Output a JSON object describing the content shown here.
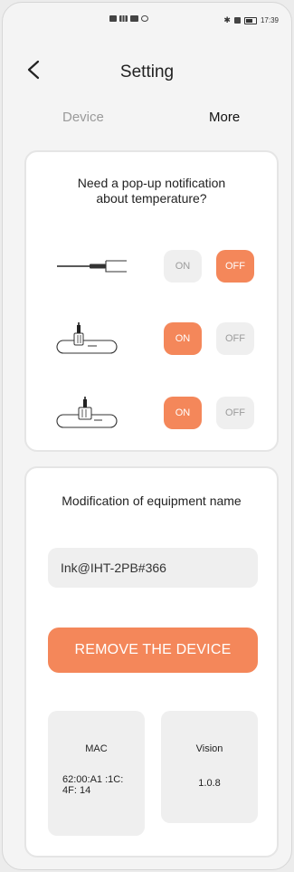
{
  "status_bar": {
    "time": "17:39"
  },
  "header": {
    "title": "Setting"
  },
  "tabs": [
    {
      "label": "Device"
    },
    {
      "label": "More"
    }
  ],
  "notification_card": {
    "question_line1": "Need a pop-up notification",
    "question_line2": "about temperature?",
    "rows": [
      {
        "on_label": "ON",
        "off_label": "OFF",
        "state": "OFF"
      },
      {
        "on_label": "ON",
        "off_label": "OFF",
        "state": "ON"
      },
      {
        "on_label": "ON",
        "off_label": "OFF",
        "state": "ON"
      }
    ]
  },
  "equipment_card": {
    "title": "Modification of equipment name",
    "name_value": "Ink@IHT-2PB#366",
    "remove_label": "REMOVE THE DEVICE",
    "mac": {
      "label": "MAC",
      "value": "62:00:A1 :1C:4F: 14"
    },
    "vision": {
      "label": "Vision",
      "value": "1.0.8"
    }
  },
  "colors": {
    "accent": "#f4875a",
    "pill_inactive": "#efefef",
    "background": "#f4f4f4"
  }
}
